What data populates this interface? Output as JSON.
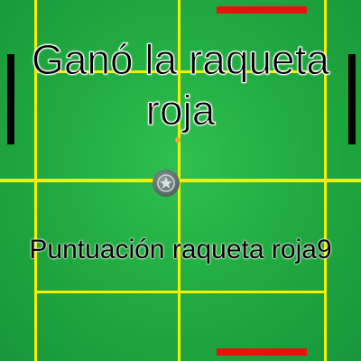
{
  "game": {
    "winner_message": "Ganó la raqueta roja",
    "score_label": "Puntuación raqueta roja",
    "score_value": "9"
  },
  "colors": {
    "court_green": "#22ac42",
    "court_lines": "#f3f000",
    "paddle_red": "#e8120c",
    "wall_black": "#000000"
  },
  "icons": {
    "center_ball": "star-ball-icon",
    "small_ball": "ball-icon"
  }
}
